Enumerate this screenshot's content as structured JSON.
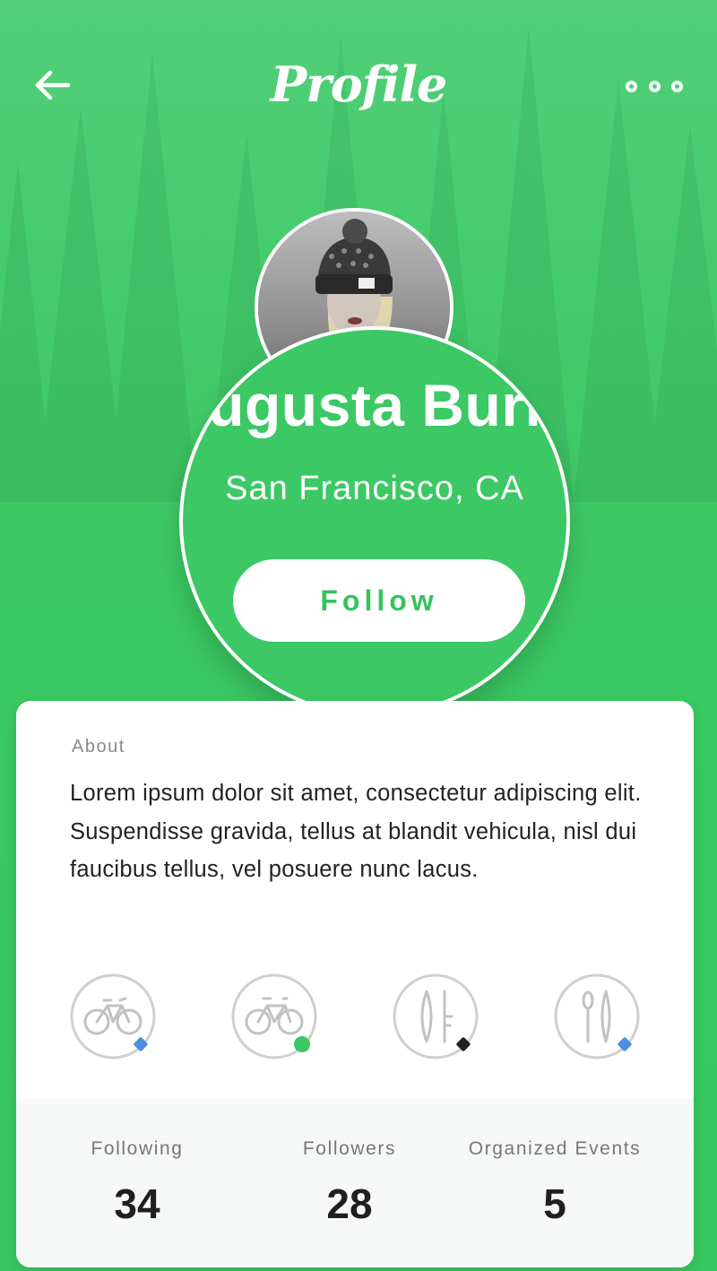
{
  "header": {
    "title": "Profile",
    "back_icon": "arrow-left-icon",
    "more_icon": "more-dots-icon"
  },
  "profile": {
    "name": "Augusta Burns",
    "location": "San Francisco, CA",
    "follow_label": "Follow",
    "avatar": "profile-photo"
  },
  "about": {
    "label": "About",
    "text": "Lorem ipsum dolor sit amet, consectetur adipiscing elit. Suspendisse gravida, tellus at blandit vehicula, nisl dui faucibus tellus, vel posuere nunc lacus."
  },
  "activities": [
    {
      "icon": "bicycle-icon",
      "badge_color": "#4a90e2",
      "badge_shape": "diamond"
    },
    {
      "icon": "bicycle-icon",
      "badge_color": "#3cc864",
      "badge_shape": "circle"
    },
    {
      "icon": "surfboard-icon",
      "badge_color": "#222222",
      "badge_shape": "diamond"
    },
    {
      "icon": "paddle-icon",
      "badge_color": "#4a90e2",
      "badge_shape": "diamond"
    }
  ],
  "stats": [
    {
      "label": "Following",
      "value": "34"
    },
    {
      "label": "Followers",
      "value": "28"
    },
    {
      "label": "Organized Events",
      "value": "5"
    }
  ],
  "colors": {
    "accent": "#3cc864",
    "card": "#ffffff",
    "stats_bg": "#f6f7f7"
  }
}
